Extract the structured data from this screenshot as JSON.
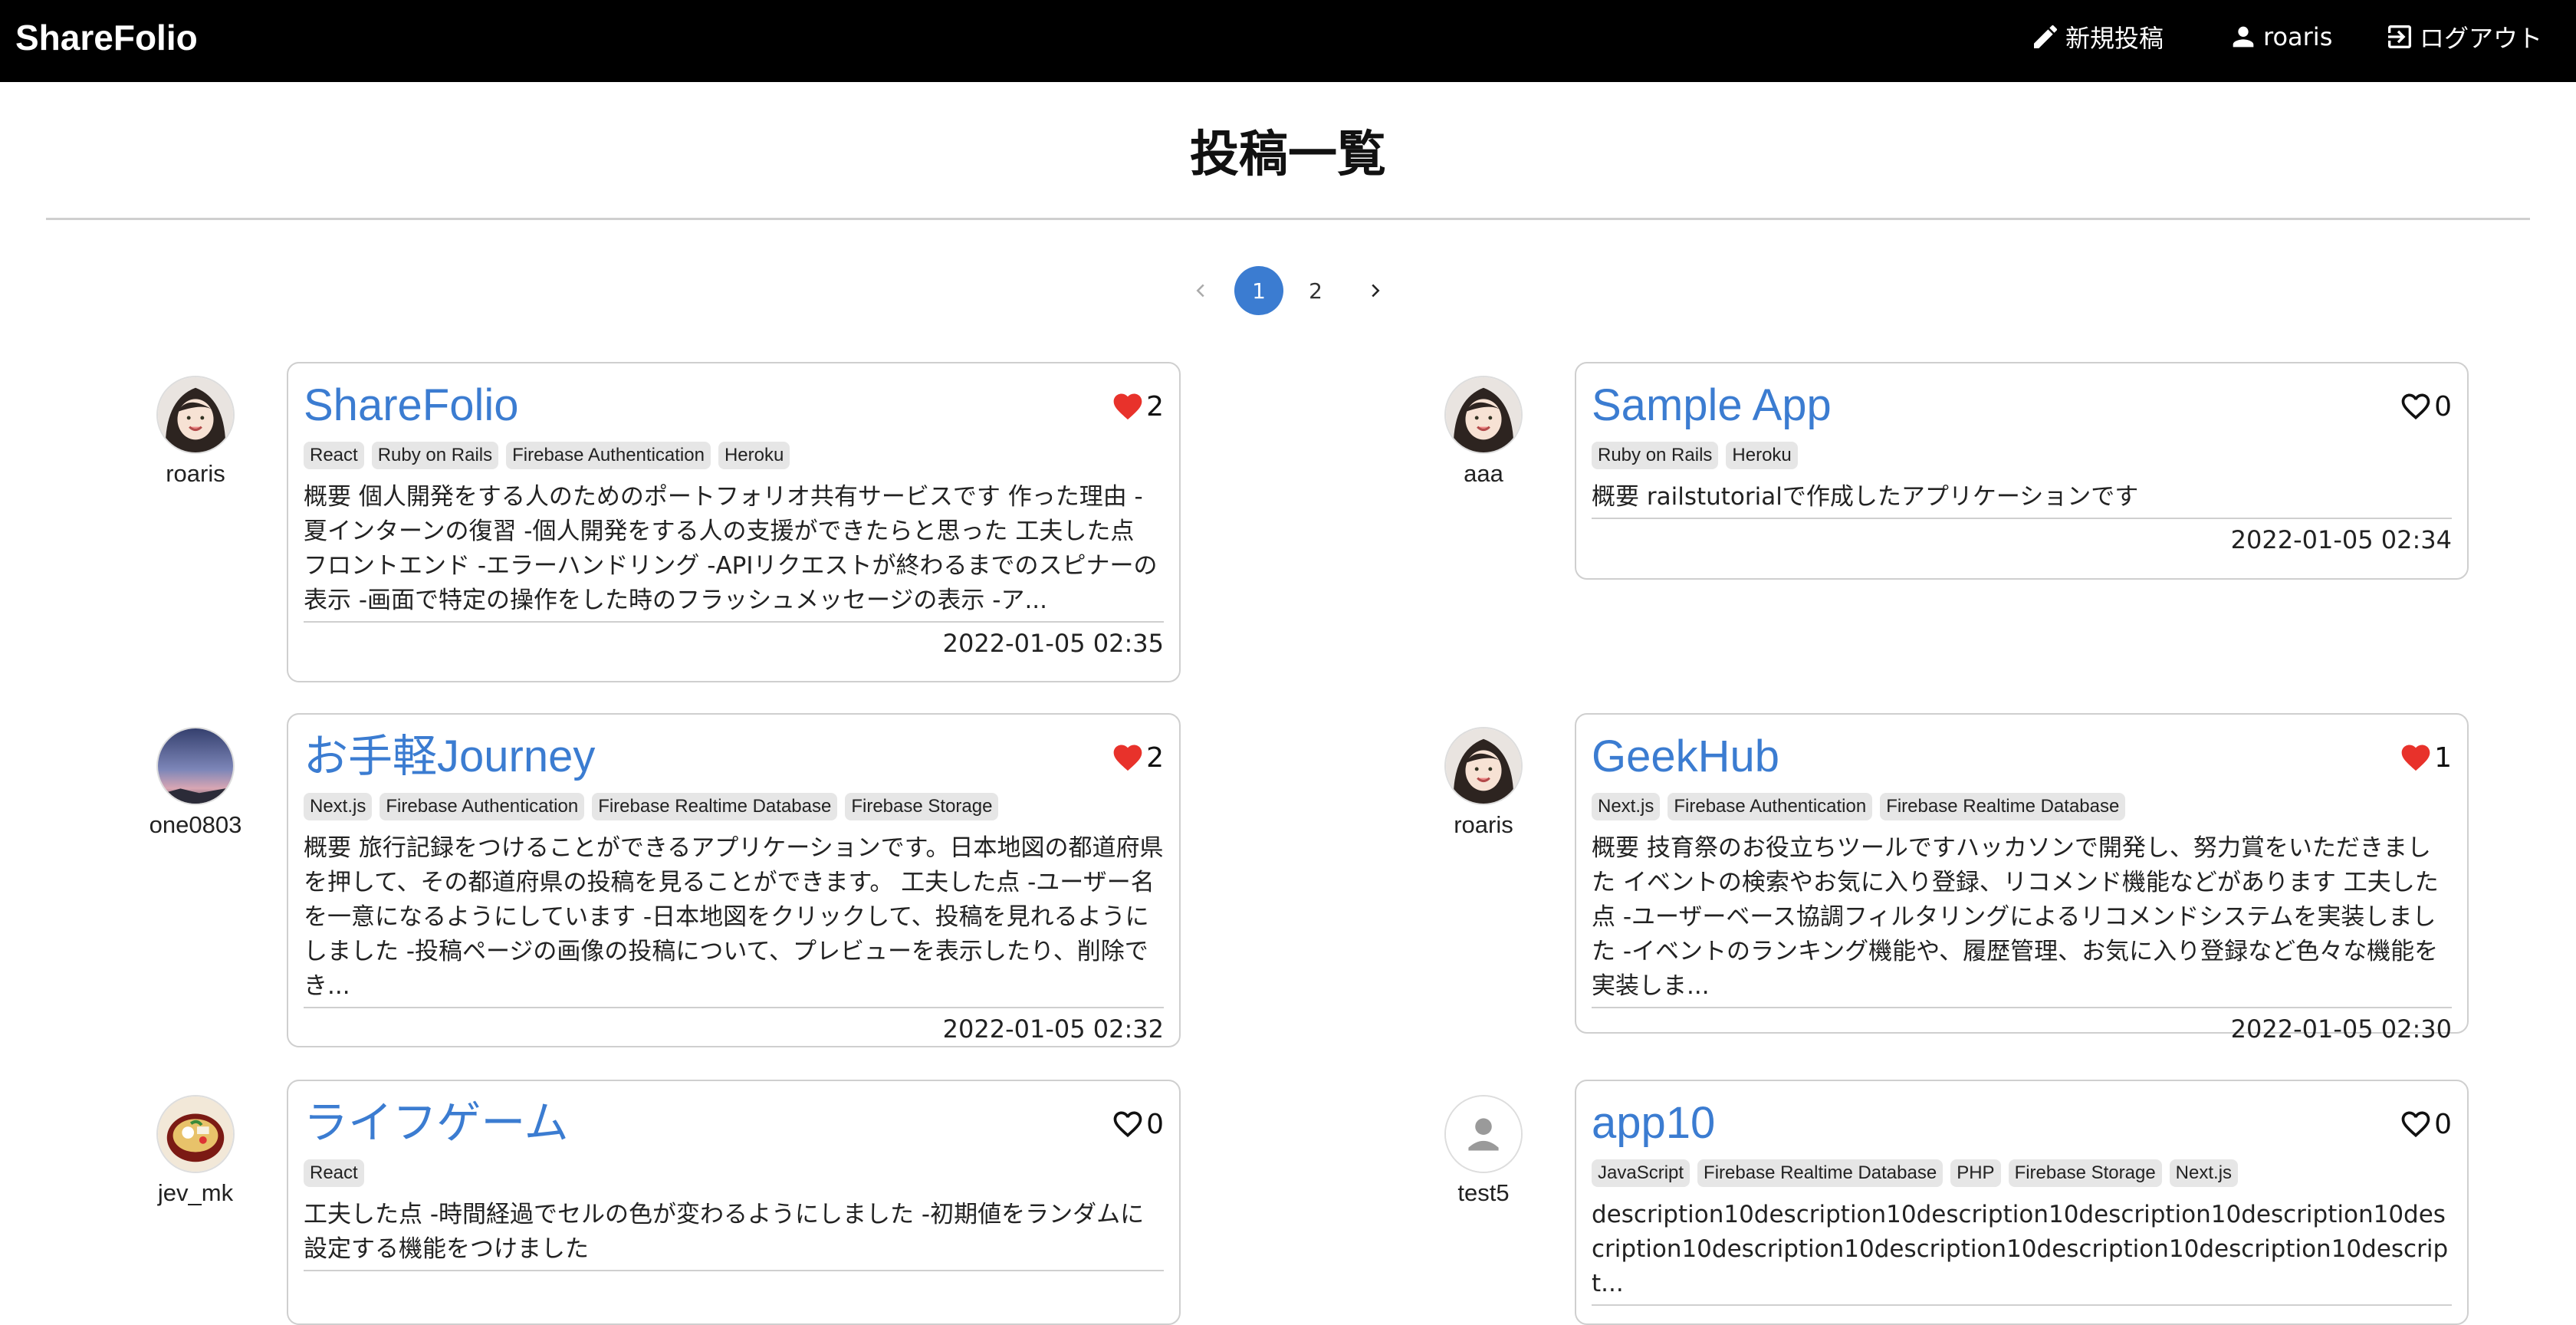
{
  "nav": {
    "brand": "ShareFolio",
    "new_post": "新規投稿",
    "user": "roaris",
    "logout": "ログアウト"
  },
  "page": {
    "title": "投稿一覧"
  },
  "pagination": {
    "pages": [
      "1",
      "2"
    ],
    "current": "1"
  },
  "posts": [
    {
      "author": "roaris",
      "avatar": "avatar-girl",
      "title": "ShareFolio",
      "liked": true,
      "likes": "2",
      "tags": [
        "React",
        "Ruby on Rails",
        "Firebase Authentication",
        "Heroku"
      ],
      "description": "概要 個人開発をする人のためのポートフォリオ共有サービスです 作った理由 -夏インターンの復習 -個人開発をする人の支援ができたらと思った 工夫した点 フロントエンド -エラーハンドリング -APIリクエストが終わるまでのスピナーの表示 -画面で特定の操作をした時のフラッシュメッセージの表示 -ア...",
      "date": "2022-01-05 02:35"
    },
    {
      "author": "aaa",
      "avatar": "avatar-girl",
      "title": "Sample App",
      "liked": false,
      "likes": "0",
      "tags": [
        "Ruby on Rails",
        "Heroku"
      ],
      "description": "概要 railstutorialで作成したアプリケーションです",
      "date": "2022-01-05 02:34"
    },
    {
      "author": "one0803",
      "avatar": "avatar-sunset",
      "title": "お手軽Journey",
      "liked": true,
      "likes": "2",
      "tags": [
        "Next.js",
        "Firebase Authentication",
        "Firebase Realtime Database",
        "Firebase Storage"
      ],
      "description": "概要 旅行記録をつけることができるアプリケーションです。日本地図の都道府県を押して、その都道府県の投稿を見ることができます。 工夫した点 -ユーザー名を一意になるようにしています -日本地図をクリックして、投稿を見れるようにしました -投稿ページの画像の投稿について、プレビューを表示したり、削除でき...",
      "date": "2022-01-05 02:32"
    },
    {
      "author": "roaris",
      "avatar": "avatar-girl",
      "title": "GeekHub",
      "liked": true,
      "likes": "1",
      "tags": [
        "Next.js",
        "Firebase Authentication",
        "Firebase Realtime Database"
      ],
      "description": "概要 技育祭のお役立ちツールですハッカソンで開発し、努力賞をいただきました イベントの検索やお気に入り登録、リコメンド機能などがあります 工夫した点 -ユーザーベース協調フィルタリングによるリコメンドシステムを実装しました -イベントのランキング機能や、履歴管理、お気に入り登録など色々な機能を実装しま...",
      "date": "2022-01-05 02:30"
    },
    {
      "author": "jev_mk",
      "avatar": "avatar-food",
      "title": "ライフゲーム",
      "liked": false,
      "likes": "0",
      "tags": [
        "React"
      ],
      "description": "工夫した点 -時間経過でセルの色が変わるようにしました -初期値をランダムに設定する機能をつけました",
      "date": ""
    },
    {
      "author": "test5",
      "avatar": "avatar-default",
      "title": "app10",
      "liked": false,
      "likes": "0",
      "tags": [
        "JavaScript",
        "Firebase Realtime Database",
        "PHP",
        "Firebase Storage",
        "Next.js"
      ],
      "description": "description10description10description10description10description10description10description10description10description10description10descript...",
      "date": ""
    }
  ]
}
